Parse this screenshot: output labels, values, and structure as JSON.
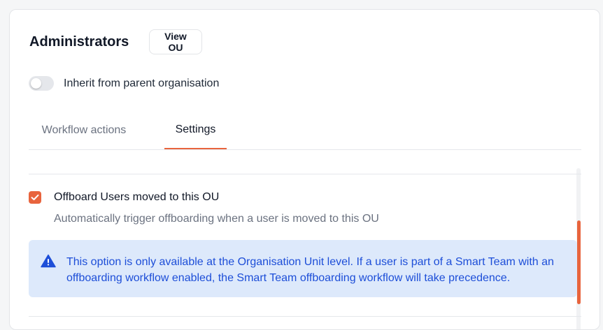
{
  "header": {
    "title": "Administrators",
    "view_button_label": "View OU"
  },
  "inherit_toggle": {
    "label": "Inherit from parent organisation",
    "enabled": false
  },
  "tabs": [
    {
      "label": "Workflow actions",
      "active": false
    },
    {
      "label": "Settings",
      "active": true
    }
  ],
  "settings": {
    "offboard_option": {
      "checked": true,
      "title": "Offboard Users moved to this OU",
      "description": "Automatically trigger offboarding when a user is moved to this OU"
    },
    "info_alert": {
      "icon": "warning-triangle-icon",
      "text": "This option is only available at the Organisation Unit level. If a user is part of a Smart Team with an offboarding workflow enabled, the Smart Team offboarding workflow will take precedence."
    }
  },
  "colors": {
    "accent": "#e8643d",
    "alert_background": "#dde9fb",
    "alert_text": "#1d4ed8"
  }
}
